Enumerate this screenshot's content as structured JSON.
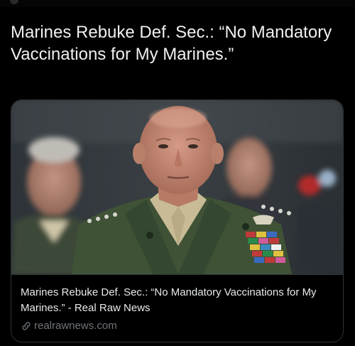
{
  "post": {
    "text": "Marines Rebuke Def. Sec.: “No Mandatory Vaccinations for My Marines.”"
  },
  "link_card": {
    "title": "Marines Rebuke Def. Sec.: “No Mandatory Vaccinations for My Marines.” - Real Raw News",
    "domain": "realrawnews.com",
    "domain_icon": "link-icon"
  },
  "colors": {
    "background": "#000000",
    "text": "#e7e9ea",
    "muted": "#71767b",
    "border": "#2f3336"
  }
}
